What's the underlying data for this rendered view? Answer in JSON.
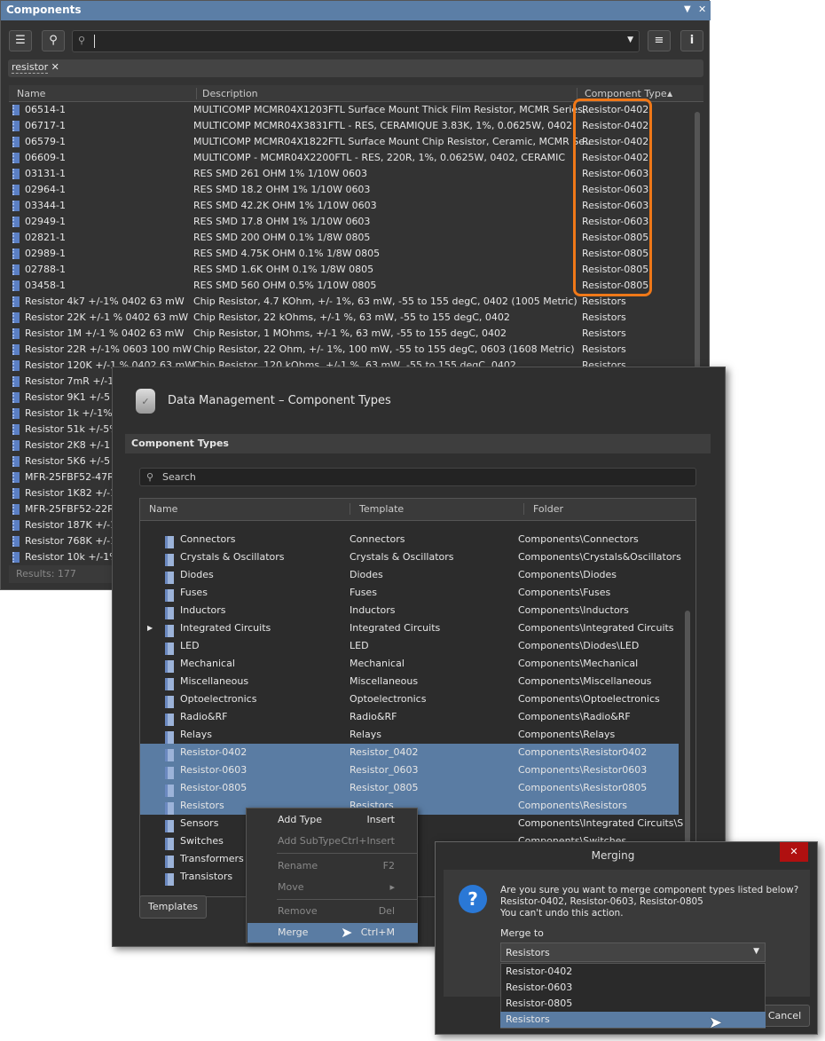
{
  "components": {
    "title": "Components",
    "search_value": "",
    "filter_chip": "resistor",
    "columns": [
      "Name",
      "Description",
      "Component Type"
    ],
    "rows": [
      [
        "06514-1",
        "MULTICOMP   MCMR04X1203FTL   Surface Mount Thick Film Resistor, MCMR Series,..",
        "Resistor-0402"
      ],
      [
        "06717-1",
        "MULTICOMP   MCMR04X3831FTL - RES, CERAMIQUE 3.83K, 1%, 0.0625W, 0402",
        "Resistor-0402"
      ],
      [
        "06579-1",
        "MULTICOMP   MCMR04X1822FTL   Surface Mount Chip Resistor, Ceramic, MCMR Se..",
        "Resistor-0402"
      ],
      [
        "06609-1",
        "MULTICOMP - MCMR04X2200FTL - RES, 220R, 1%, 0.0625W, 0402, CERAMIC",
        "Resistor-0402"
      ],
      [
        "03131-1",
        "RES SMD 261 OHM 1% 1/10W 0603",
        "Resistor-0603"
      ],
      [
        "02964-1",
        "RES SMD 18.2 OHM 1% 1/10W 0603",
        "Resistor-0603"
      ],
      [
        "03344-1",
        "RES SMD 42.2K OHM 1% 1/10W 0603",
        "Resistor-0603"
      ],
      [
        "02949-1",
        "RES SMD 17.8 OHM 1% 1/10W 0603",
        "Resistor-0603"
      ],
      [
        "02821-1",
        "RES SMD 200 OHM 0.1% 1/8W 0805",
        "Resistor-0805"
      ],
      [
        "02989-1",
        "RES SMD 4.75K OHM 0.1% 1/8W 0805",
        "Resistor-0805"
      ],
      [
        "02788-1",
        "RES SMD 1.6K OHM 0.1% 1/8W 0805",
        "Resistor-0805"
      ],
      [
        "03458-1",
        "RES SMD 560 OHM 0.5% 1/10W 0805",
        "Resistor-0805"
      ],
      [
        "Resistor 4k7 +/-1% 0402 63 mW",
        "Chip Resistor, 4.7 KOhm, +/- 1%, 63 mW, -55 to 155 degC, 0402 (1005 Metric)",
        "Resistors"
      ],
      [
        "Resistor 22K  +/-1 % 0402 63 mW",
        "Chip Resistor, 22 kOhms, +/-1 %, 63 mW, -55 to 155 degC, 0402",
        "Resistors"
      ],
      [
        "Resistor 1M +/-1 % 0402 63 mW",
        "Chip Resistor, 1 MOhms, +/-1 %, 63 mW, -55 to 155 degC, 0402",
        "Resistors"
      ],
      [
        "Resistor 22R +/-1% 0603 100 mW",
        "Chip Resistor, 22 Ohm, +/- 1%, 100 mW, -55 to 155 degC, 0603 (1608 Metric)",
        "Resistors"
      ],
      [
        "Resistor 120K +/-1 % 0402 63 mW",
        "Chip Resistor, 120 kOhms, +/-1 %, 63 mW, -55 to 155 degC, 0402",
        "Resistors"
      ],
      [
        "Resistor 7mR +/-1",
        "",
        ""
      ],
      [
        "Resistor 9K1  +/-5",
        "",
        ""
      ],
      [
        "Resistor 1k +/-1%",
        "",
        ""
      ],
      [
        "Resistor 51k +/-5%",
        "",
        ""
      ],
      [
        "Resistor 2K8  +/-1",
        "",
        ""
      ],
      [
        "Resistor 5K6  +/-5",
        "",
        ""
      ],
      [
        "MFR-25FBF52-47R",
        "",
        ""
      ],
      [
        "Resistor 1K82 +/-1",
        "",
        ""
      ],
      [
        "MFR-25FBF52-22R",
        "",
        ""
      ],
      [
        "Resistor 187K +/-1",
        "",
        ""
      ],
      [
        "Resistor 768K +/-1",
        "",
        ""
      ],
      [
        "Resistor 10k +/-1%",
        "",
        ""
      ]
    ],
    "results": "Results: 177",
    "highlight_color": "#f07818"
  },
  "data_management": {
    "title": "Data Management – Component Types",
    "section": "Component Types",
    "search_placeholder": "Search",
    "columns": [
      "Name",
      "Template",
      "Folder"
    ],
    "rows": [
      [
        "Connectors",
        "Connectors",
        "Components\\Connectors"
      ],
      [
        "Crystals & Oscillators",
        "Crystals & Oscillators",
        "Components\\Crystals&Oscillators"
      ],
      [
        "Diodes",
        "Diodes",
        "Components\\Diodes"
      ],
      [
        "Fuses",
        "Fuses",
        "Components\\Fuses"
      ],
      [
        "Inductors",
        "Inductors",
        "Components\\Inductors"
      ],
      [
        "Integrated Circuits",
        "Integrated Circuits",
        "Components\\Integrated Circuits"
      ],
      [
        "LED",
        "LED",
        "Components\\Diodes\\LED"
      ],
      [
        "Mechanical",
        "Mechanical",
        "Components\\Mechanical"
      ],
      [
        "Miscellaneous",
        "Miscellaneous",
        "Components\\Miscellaneous"
      ],
      [
        "Optoelectronics",
        "Optoelectronics",
        "Components\\Optoelectronics"
      ],
      [
        "Radio&RF",
        "Radio&RF",
        "Components\\Radio&RF"
      ],
      [
        "Relays",
        "Relays",
        "Components\\Relays"
      ],
      [
        "Resistor-0402",
        "Resistor_0402",
        "Components\\Resistor0402"
      ],
      [
        "Resistor-0603",
        "Resistor_0603",
        "Components\\Resistor0603"
      ],
      [
        "Resistor-0805",
        "Resistor_0805",
        "Components\\Resistor0805"
      ],
      [
        "Resistors",
        "Resistors",
        "Components\\Resistors"
      ],
      [
        "Sensors",
        "",
        "Components\\Integrated Circuits\\S"
      ],
      [
        "Switches",
        "",
        "Components\\Switches"
      ],
      [
        "Transformers",
        "",
        ""
      ],
      [
        "Transistors",
        "",
        ""
      ]
    ],
    "selected": [
      12,
      13,
      14,
      15
    ],
    "templates_button": "Templates"
  },
  "context_menu": [
    {
      "label": "Add Type",
      "shortcut": "Insert",
      "enabled": true
    },
    {
      "label": "Add SubType",
      "shortcut": "Ctrl+Insert",
      "enabled": false
    },
    {
      "label": "Rename",
      "shortcut": "F2",
      "enabled": false
    },
    {
      "label": "Move",
      "shortcut": "▸",
      "enabled": false
    },
    {
      "label": "Remove",
      "shortcut": "Del",
      "enabled": false
    },
    {
      "label": "Merge",
      "shortcut": "Ctrl+M",
      "enabled": true
    }
  ],
  "merging": {
    "title": "Merging",
    "close": "✕",
    "line1": "Are you sure you want to merge component types listed below?",
    "line2": "Resistor-0402, Resistor-0603, Resistor-0805",
    "line3": "You can't undo this action.",
    "merge_to_label": "Merge to",
    "selected": "Resistors",
    "options": [
      "Resistor-0402",
      "Resistor-0603",
      "Resistor-0805",
      "Resistors"
    ],
    "cancel": "Cancel"
  }
}
